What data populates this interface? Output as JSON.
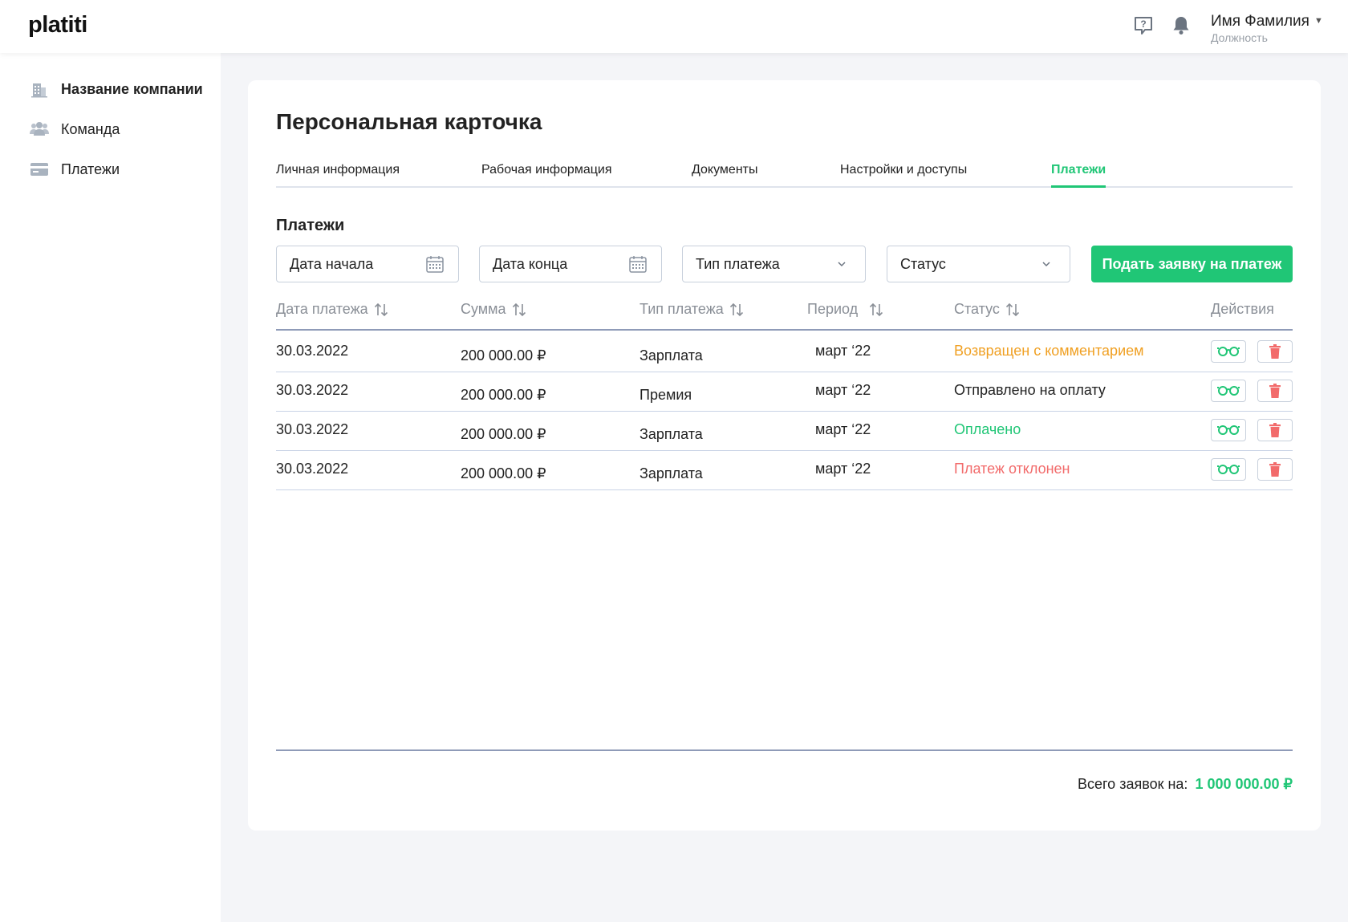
{
  "app": {
    "logo": "platiti"
  },
  "user": {
    "name": "Имя Фамилия",
    "role": "Должность"
  },
  "sidebar": {
    "items": [
      {
        "label": "Название компании"
      },
      {
        "label": "Команда"
      },
      {
        "label": "Платежи"
      }
    ]
  },
  "page": {
    "title": "Персональная карточка"
  },
  "tabs": [
    {
      "label": "Личная информация"
    },
    {
      "label": "Рабочая информация"
    },
    {
      "label": "Документы"
    },
    {
      "label": "Настройки и доступы"
    },
    {
      "label": "Платежи",
      "active": true
    }
  ],
  "payments": {
    "title": "Платежи",
    "filters": {
      "start_date": "Дата начала",
      "end_date": "Дата конца",
      "payment_type": "Тип платежа",
      "status": "Статус"
    },
    "submit_label": "Подать заявку на платеж",
    "columns": {
      "date": "Дата платежа",
      "sum": "Сумма",
      "type": "Тип платежа",
      "period": "Период",
      "status": "Статус",
      "actions": "Действия"
    },
    "rows": [
      {
        "date": "30.03.2022",
        "sum": "200 000.00  ₽",
        "type": "Зарплата",
        "period": "март ‘22",
        "status": "Возвращен с комментарием",
        "status_color": "#f0a023"
      },
      {
        "date": "30.03.2022",
        "sum": "200 000.00  ₽",
        "type": "Премия",
        "period": "март ‘22",
        "status": "Отправлено на оплату",
        "status_color": "#222222"
      },
      {
        "date": "30.03.2022",
        "sum": "200 000.00  ₽",
        "type": "Зарплата",
        "period": "март  ‘22",
        "status": "Оплачено",
        "status_color": "#20c676"
      },
      {
        "date": "30.03.2022",
        "sum": "200 000.00  ₽",
        "type": "Зарплата",
        "period": "март  ‘22",
        "status": "Платеж отклонен",
        "status_color": "#f26b6b"
      }
    ],
    "total_label": "Всего заявок на:",
    "total_value": "1 000 000.00 ₽"
  },
  "colors": {
    "accent": "#20c676",
    "danger": "#f26b6b",
    "warning": "#f0a023"
  }
}
